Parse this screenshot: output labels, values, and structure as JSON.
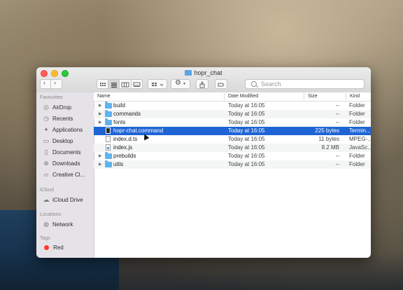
{
  "window": {
    "title": "hopr_chat"
  },
  "toolbar": {
    "back_icon": "chevron-left",
    "forward_icon": "chevron-right",
    "view_icons": [
      "grid",
      "list",
      "columns",
      "gallery"
    ],
    "search_placeholder": "Search"
  },
  "sidebar": {
    "sections": [
      {
        "heading": "Favourites",
        "items": [
          {
            "label": "AirDrop",
            "icon": "airdrop-icon"
          },
          {
            "label": "Recents",
            "icon": "clock-icon"
          },
          {
            "label": "Applications",
            "icon": "applications-icon"
          },
          {
            "label": "Desktop",
            "icon": "desktop-icon"
          },
          {
            "label": "Documents",
            "icon": "document-icon"
          },
          {
            "label": "Downloads",
            "icon": "download-icon"
          },
          {
            "label": "Creative Cl...",
            "icon": "folder-icon"
          }
        ]
      },
      {
        "heading": "iCloud",
        "items": [
          {
            "label": "iCloud Drive",
            "icon": "cloud-icon"
          }
        ]
      },
      {
        "heading": "Locations",
        "items": [
          {
            "label": "Network",
            "icon": "globe-icon"
          }
        ]
      },
      {
        "heading": "Tags",
        "items": [
          {
            "label": "Red",
            "color": "#ff3b30"
          }
        ]
      }
    ]
  },
  "table": {
    "columns": {
      "name": "Name",
      "date": "Date Modified",
      "size": "Size",
      "kind": "Kind"
    },
    "rows": [
      {
        "name": "build",
        "date": "Today at 16:05",
        "size": "--",
        "kind": "Folder",
        "type": "folder"
      },
      {
        "name": "commands",
        "date": "Today at 16:05",
        "size": "--",
        "kind": "Folder",
        "type": "folder"
      },
      {
        "name": "fonts",
        "date": "Today at 16:05",
        "size": "--",
        "kind": "Folder",
        "type": "folder"
      },
      {
        "name": "hopr-chat.command",
        "date": "Today at 16:05",
        "size": "225 bytes",
        "kind": "Termin...",
        "type": "exec",
        "selected": true
      },
      {
        "name": "index.d.ts",
        "date": "Today at 16:05",
        "size": "11 bytes",
        "kind": "MPEG-...",
        "type": "file"
      },
      {
        "name": "index.js",
        "date": "Today at 16:05",
        "size": "8.2 MB",
        "kind": "JavaSc...",
        "type": "js"
      },
      {
        "name": "prebuilds",
        "date": "Today at 16:05",
        "size": "--",
        "kind": "Folder",
        "type": "folder"
      },
      {
        "name": "utils",
        "date": "Today at 16:05",
        "size": "--",
        "kind": "Folder",
        "type": "folder"
      }
    ]
  },
  "colors": {
    "selection": "#1f64d4",
    "folder": "#5fb4ef"
  }
}
